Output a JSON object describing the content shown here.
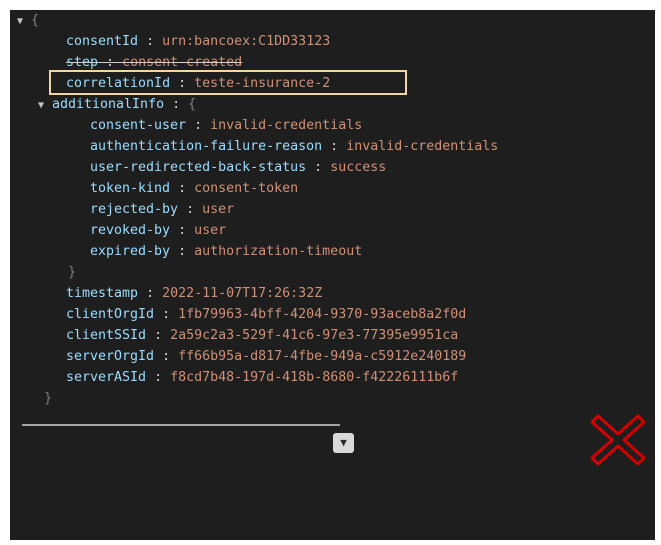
{
  "json_viewer": {
    "open_brace": "{",
    "close_brace": "}",
    "fields": [
      {
        "key": "consentId",
        "value": "urn:bancoex:C1DD33123"
      },
      {
        "key": "step",
        "value": "consent-created"
      },
      {
        "key": "correlationId",
        "value": "teste-insurance-2"
      },
      {
        "key": "additionalInfo",
        "open": "{"
      }
    ],
    "additional_info": [
      {
        "key": "consent-user",
        "value": "invalid-credentials"
      },
      {
        "key": "authentication-failure-reason",
        "value": "invalid-credentials"
      },
      {
        "key": "user-redirected-back-status",
        "value": "success"
      },
      {
        "key": "token-kind",
        "value": "consent-token"
      },
      {
        "key": "rejected-by",
        "value": "user"
      },
      {
        "key": "revoked-by",
        "value": "user"
      },
      {
        "key": "expired-by",
        "value": "authorization-timeout"
      }
    ],
    "additional_info_close": "}",
    "trailing_fields": [
      {
        "key": "timestamp",
        "value": "2022-11-07T17:26:32Z"
      },
      {
        "key": "clientOrgId",
        "value": "1fb79963-4bff-4204-9370-93aceb8a2f0d"
      },
      {
        "key": "clientSSId",
        "value": "2a59c2a3-529f-41c6-97e3-77395e9951ca"
      },
      {
        "key": "serverOrgId",
        "value": "ff66b95a-d817-4fbe-949a-c5912e240189"
      },
      {
        "key": "serverASId",
        "value": "f8cd7b48-197d-418b-8680-f42226111b6f"
      }
    ],
    "separator": " : ",
    "caret_down": "▼"
  },
  "colors": {
    "background": "#1e1e1e",
    "key": "#9cdcfe",
    "string": "#ce9178",
    "highlight_border": "#f3d7a0",
    "x_mark": "#d40000"
  }
}
